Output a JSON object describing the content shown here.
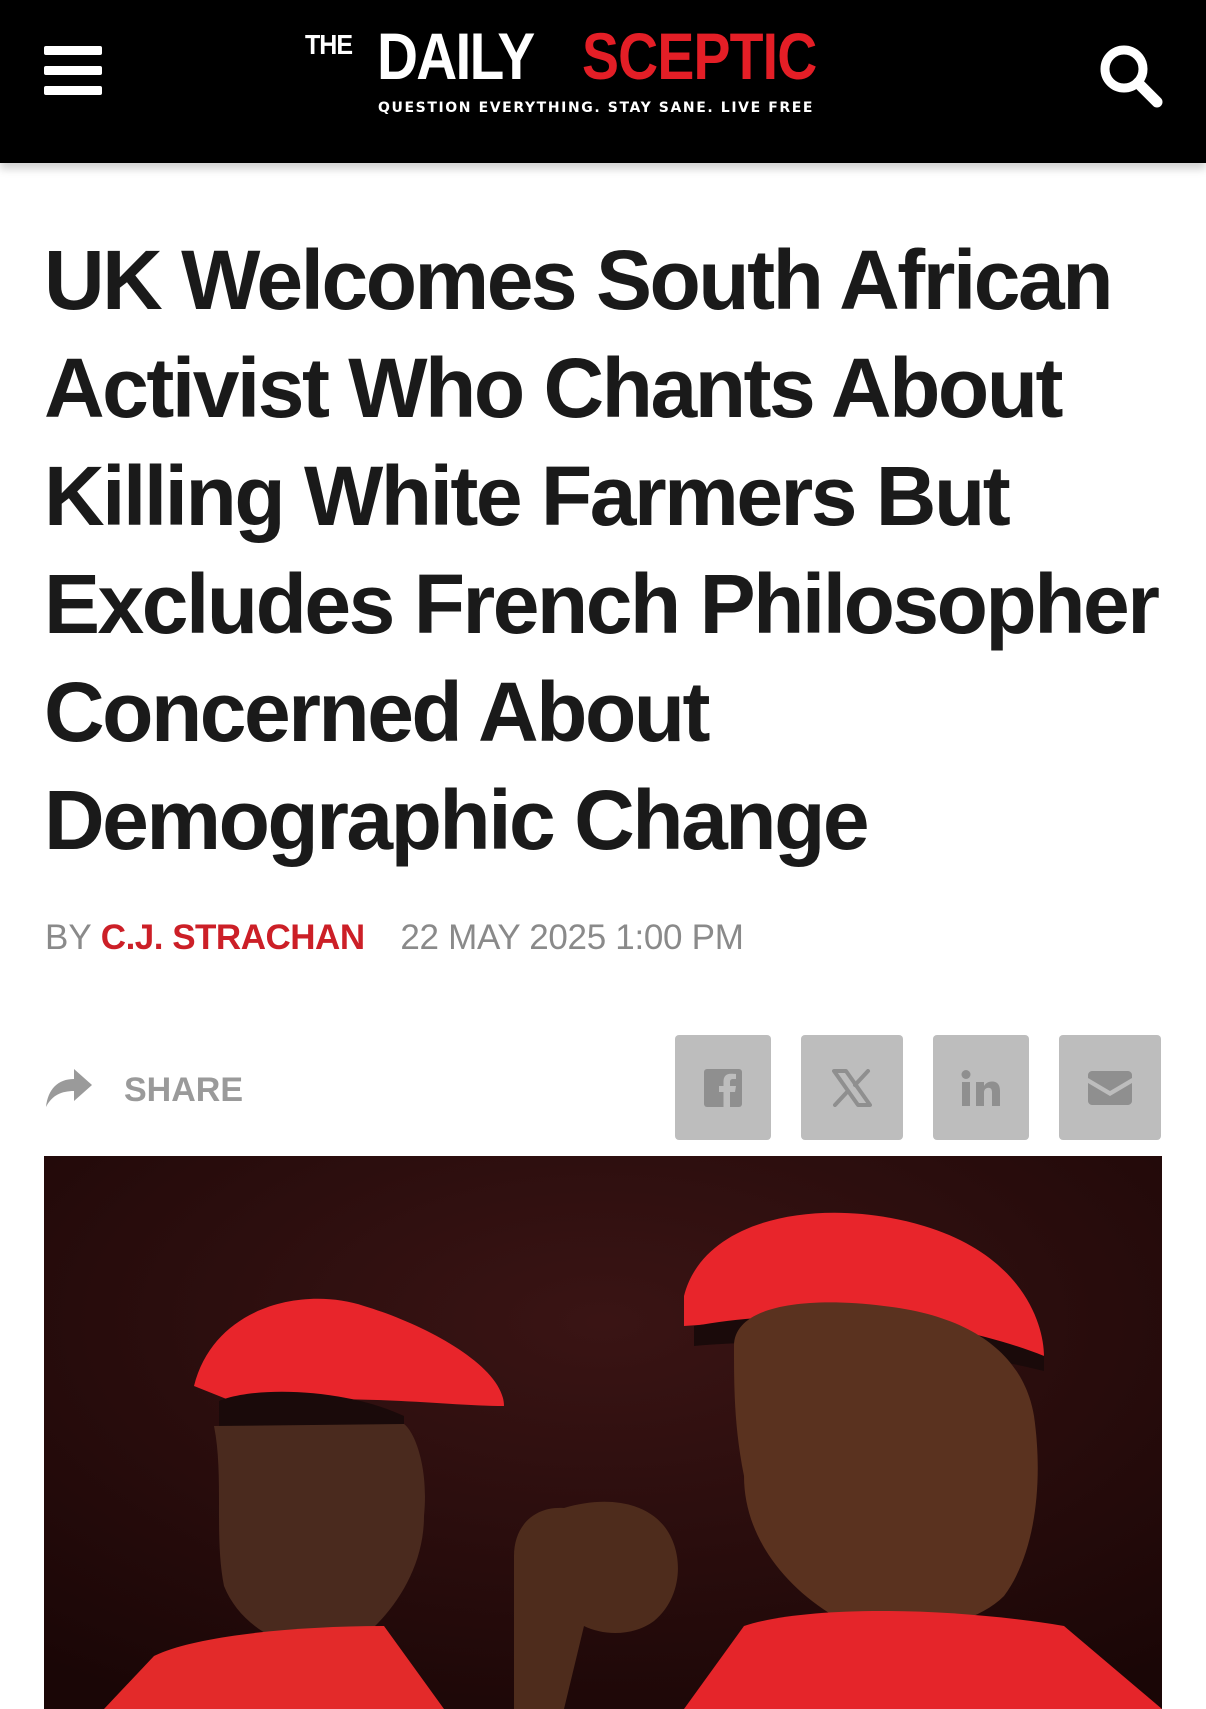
{
  "header": {
    "logo": {
      "the": "THE",
      "daily": "DAILY",
      "sceptic": "SCEPTIC"
    },
    "tagline": "QUESTION EVERYTHING. STAY SANE. LIVE FREE",
    "menu_icon": "hamburger-menu-icon",
    "search_icon": "search-icon"
  },
  "article": {
    "headline": "UK Welcomes South African Activist Who Chants About Killing White Farmers But Excludes French Philosopher Concerned About Demographic Change",
    "byline_prefix": "BY",
    "author": "C.J. STRACHAN",
    "date": "22 MAY 2025 1:00 PM"
  },
  "share": {
    "label": "SHARE",
    "buttons": [
      {
        "network": "facebook",
        "icon": "facebook-icon"
      },
      {
        "network": "x",
        "icon": "x-icon"
      },
      {
        "network": "linkedin",
        "icon": "linkedin-icon"
      },
      {
        "network": "email",
        "icon": "email-icon"
      }
    ]
  },
  "colors": {
    "header_bg": "#000000",
    "brand_red": "#e41e26",
    "author_red": "#cc1f27",
    "button_grey": "#bdbdbd",
    "headline": "#1a1a1a"
  }
}
